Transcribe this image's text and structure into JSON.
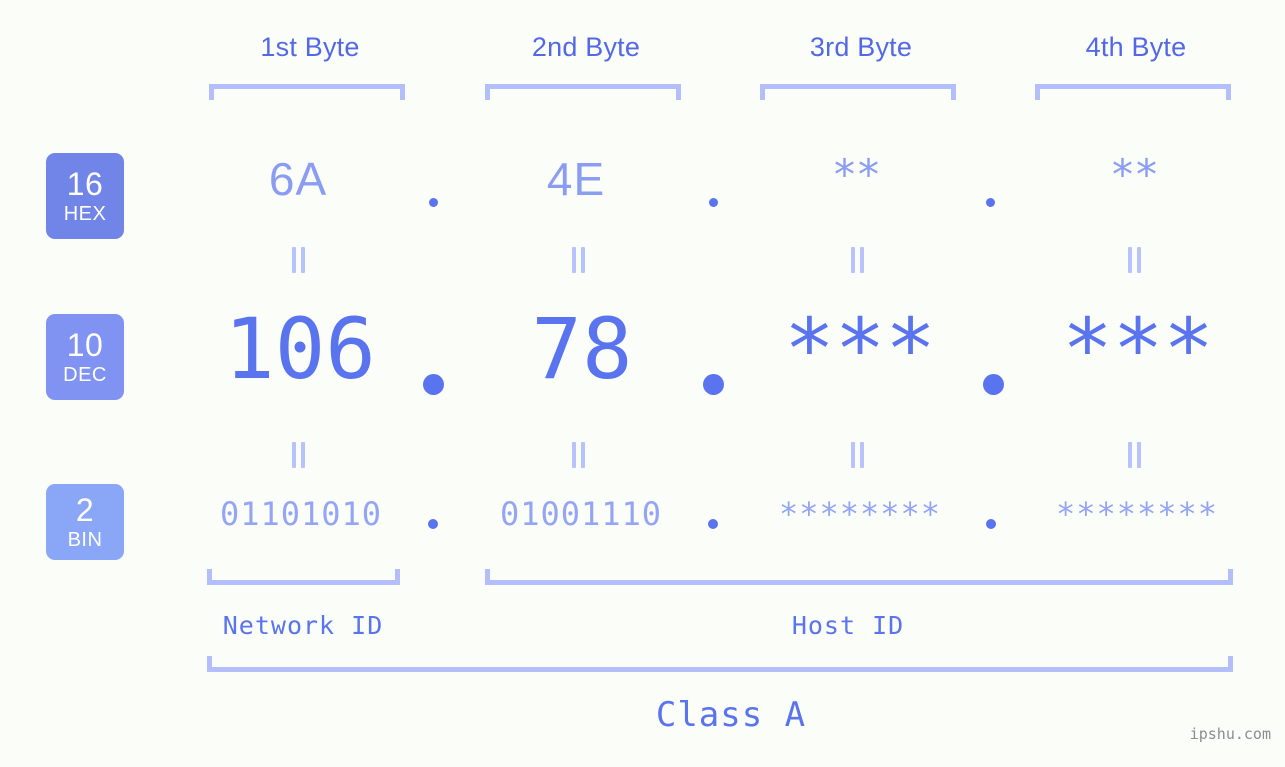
{
  "meta": {
    "background": "#fbfdf8",
    "accent_dark": "#5a73ef",
    "accent_mid": "#8b9cf3",
    "accent_light": "#b3befb"
  },
  "headers": [
    {
      "label": "1st Byte"
    },
    {
      "label": "2nd Byte"
    },
    {
      "label": "3rd Byte"
    },
    {
      "label": "4th Byte"
    }
  ],
  "rows": {
    "hex": {
      "badge_num": "16",
      "badge_abbr": "HEX",
      "values": [
        "6A",
        "4E",
        "**",
        "**"
      ]
    },
    "dec": {
      "badge_num": "10",
      "badge_abbr": "DEC",
      "values": [
        "106",
        "78",
        "***",
        "***"
      ]
    },
    "bin": {
      "badge_num": "2",
      "badge_abbr": "BIN",
      "values": [
        "01101010",
        "01001110",
        "********",
        "********"
      ]
    }
  },
  "separators": {
    "hex": [
      ".",
      ".",
      "."
    ],
    "dec": [
      ".",
      ".",
      "."
    ],
    "bin": [
      ".",
      ".",
      "."
    ]
  },
  "equals_symbol": "=",
  "id_labels": {
    "network": "Network ID",
    "host": "Host ID"
  },
  "class_label": "Class A",
  "watermark": "ipshu.com"
}
